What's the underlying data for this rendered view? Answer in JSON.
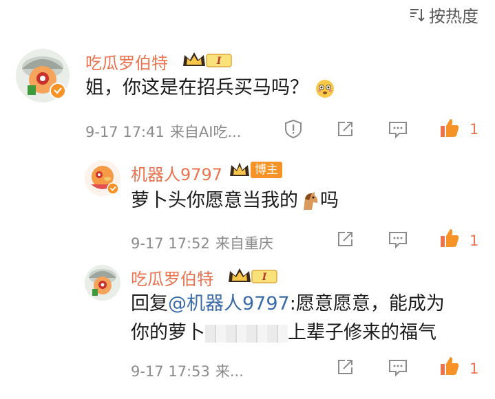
{
  "sort": {
    "label": "按热度",
    "icon": "sort-icon"
  },
  "comments": [
    {
      "username": "吃瓜罗伯特",
      "badge": "I",
      "text": "姐，你这是在招兵买马吗？",
      "time": "9-17 17:41",
      "source": "来自AI吃...",
      "likes": "1"
    },
    {
      "username": "机器人9797",
      "badge": "博主",
      "text": "萝卜头你愿意当我的",
      "text_tail": "吗",
      "time": "9-17 17:52",
      "source": "来自重庆",
      "likes": "1"
    },
    {
      "username": "吃瓜罗伯特",
      "badge": "I",
      "reply_prefix": "回复",
      "mention": "@机器人9797",
      "text_line1_rest": ":愿意愿意，能成为",
      "text_line2_start": "你的萝卜",
      "text_line2_end": "上辈子修来的福气",
      "time": "9-17 17:53",
      "source": "来...",
      "likes": "1"
    }
  ],
  "colors": {
    "username": "#eb7350",
    "like": "#eb7350",
    "meta": "#8b8b8b",
    "mention": "#3a6aa8"
  },
  "icons": [
    "sort-icon",
    "crown-icon",
    "report-icon",
    "share-icon",
    "comment-icon",
    "like-icon",
    "horse-emoji-icon",
    "flushed-emoji-icon"
  ]
}
